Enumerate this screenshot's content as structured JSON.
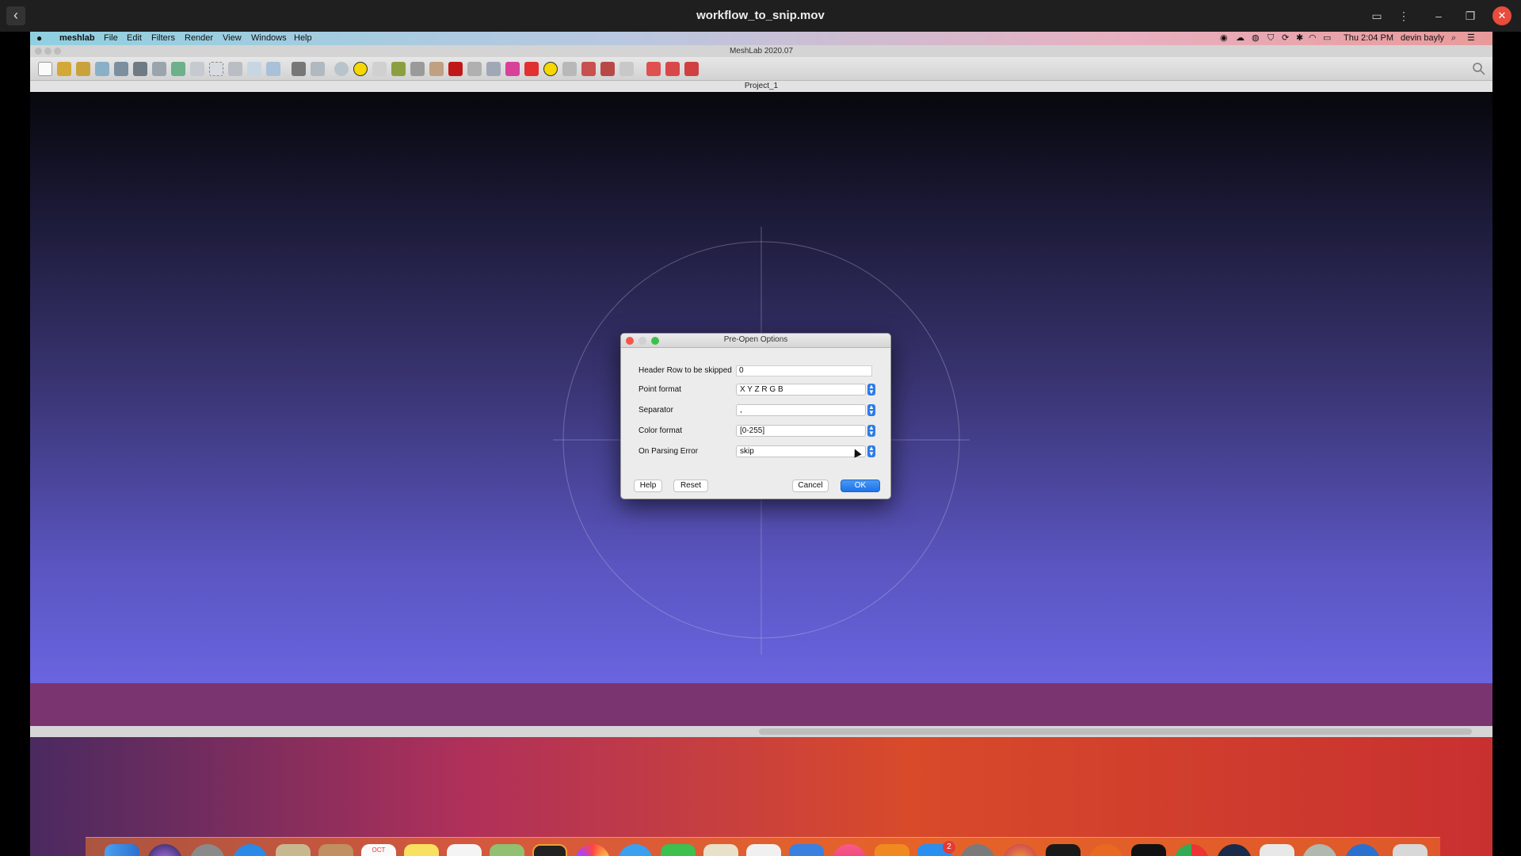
{
  "player": {
    "title": "workflow_to_snip.mov",
    "back_icon": "‹",
    "controls": [
      "cast-icon",
      "more-icon",
      "minimize-icon",
      "maximize-icon",
      "close-icon"
    ]
  },
  "menubar": {
    "app_name": "meshlab",
    "items": [
      "File",
      "Edit",
      "Filters",
      "Render",
      "View",
      "Windows",
      "Help"
    ],
    "clock": "Thu 2:04 PM",
    "user": "devin bayly"
  },
  "window": {
    "app_title": "MeshLab 2020.07",
    "project_title": "Project_1"
  },
  "dialog": {
    "title": "Pre-Open Options",
    "rows": [
      {
        "label": "Header Row to be skipped",
        "value": "0",
        "kind": "text"
      },
      {
        "label": "Point format",
        "value": "X Y Z R G B",
        "kind": "select"
      },
      {
        "label": "Separator",
        "value": ",",
        "kind": "select"
      },
      {
        "label": "Color format",
        "value": "[0-255]",
        "kind": "select"
      },
      {
        "label": "On Parsing Error",
        "value": "skip",
        "kind": "select"
      }
    ],
    "buttons": {
      "help": "Help",
      "reset": "Reset",
      "cancel": "Cancel",
      "ok": "OK"
    }
  },
  "dock": {
    "calendar_month": "OCT",
    "calendar_day": "29",
    "appstore_badge": "2"
  },
  "colors": {
    "accent": "#1d72e8",
    "viewport_top": "#07070c",
    "viewport_bottom": "#6a64e0",
    "close_red": "#e74c3c"
  }
}
